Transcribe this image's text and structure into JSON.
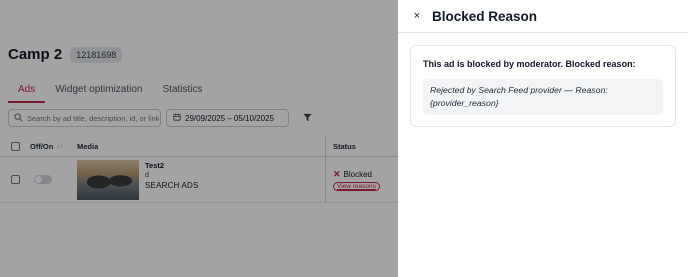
{
  "campaign": {
    "title": "Camp 2",
    "id": "12181698"
  },
  "tabs": [
    {
      "label": "Ads",
      "active": true
    },
    {
      "label": "Widget optimization",
      "active": false
    },
    {
      "label": "Statistics",
      "active": false
    }
  ],
  "filters": {
    "search_placeholder": "Search by ad title, description, id, or link",
    "date_range": "29/09/2025 – 05/10/2025"
  },
  "table": {
    "headers": {
      "off_on": "Off/On",
      "sort_glyph": "↓↑",
      "media": "Media",
      "status": "Status"
    },
    "rows": [
      {
        "title": "Test2",
        "description": "d",
        "type": "SEARCH ADS",
        "status": "Blocked",
        "status_action": "View reasons",
        "enabled": false
      }
    ]
  },
  "drawer": {
    "close_glyph": "×",
    "title": "Blocked Reason",
    "intro": "This ad is blocked by moderator. Blocked reason:",
    "reason": "Rejected by Search Feed provider — Reason: {provider_reason}"
  },
  "colors": {
    "accent": "#c0264a",
    "overlay": "rgba(0,0,0,0.36)"
  },
  "icons": [
    "search-icon",
    "calendar-icon",
    "filter-icon",
    "sort-icon",
    "close-icon",
    "blocked-x-icon"
  ]
}
